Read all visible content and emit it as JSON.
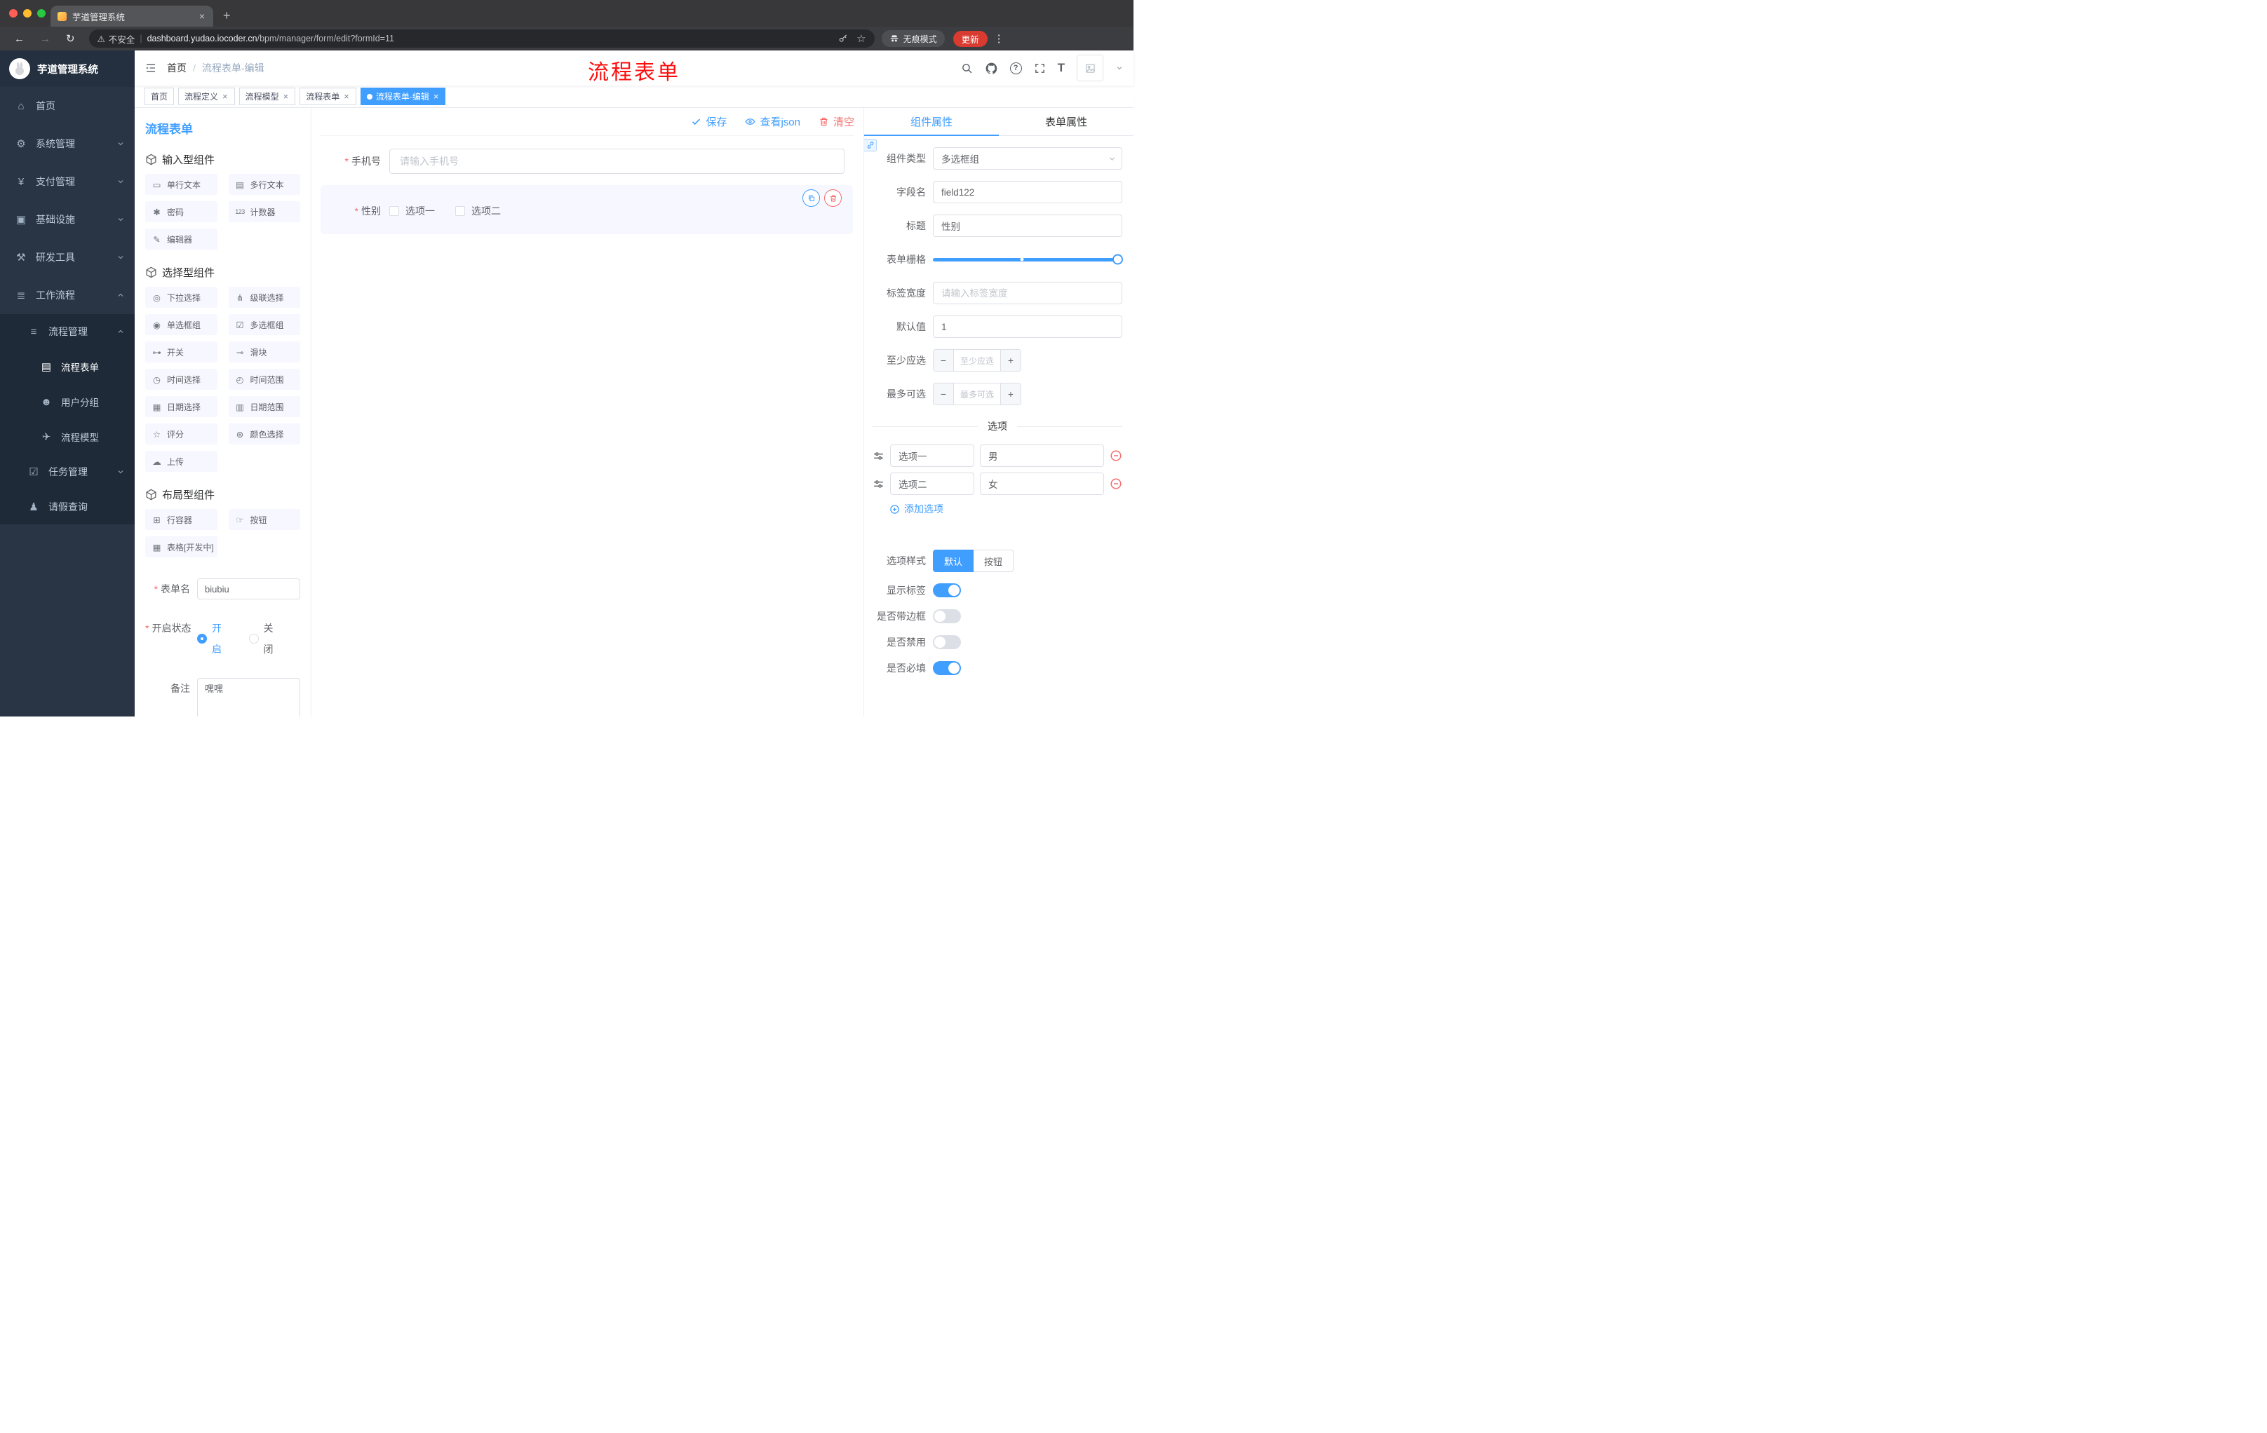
{
  "icons": {
    "close": "×",
    "plus": "+",
    "kebab": "⋮",
    "back": "←",
    "forward": "→",
    "reload": "↻",
    "star": "☆",
    "warning": "⚠",
    "pipe": "|",
    "breadcrumb_sep": "/",
    "question": "?",
    "text_size": "T"
  },
  "browser": {
    "tab_title": "芋道管理系统",
    "security_label": "不安全",
    "url_host": "dashboard.yudao.iocoder.cn",
    "url_path": "/bpm/manager/form/edit?formId=11",
    "incognito_label": "无痕模式",
    "update_label": "更新"
  },
  "sidebar": {
    "logo_title": "芋道管理系统",
    "menu": [
      {
        "label": "首页",
        "glyph": "⌂"
      },
      {
        "label": "系统管理",
        "glyph": "⚙"
      },
      {
        "label": "支付管理",
        "glyph": "¥"
      },
      {
        "label": "基础设施",
        "glyph": "▣"
      },
      {
        "label": "研发工具",
        "glyph": "⚒"
      },
      {
        "label": "工作流程",
        "glyph": "≣"
      }
    ],
    "submenu": {
      "process_mgmt": {
        "label": "流程管理",
        "glyph": "≡"
      },
      "children": [
        {
          "label": "流程表单",
          "glyph": "▤"
        },
        {
          "label": "用户分组",
          "glyph": "☻"
        },
        {
          "label": "流程模型",
          "glyph": "✈"
        }
      ],
      "task_mgmt": {
        "label": "任务管理",
        "glyph": "☑"
      },
      "leave_query": {
        "label": "请假查询",
        "glyph": "♟"
      }
    }
  },
  "header": {
    "breadcrumb_home": "首页",
    "breadcrumb_current": "流程表单-编辑",
    "overlay_title": "流程表单"
  },
  "tags": [
    {
      "label": "首页"
    },
    {
      "label": "流程定义"
    },
    {
      "label": "流程模型"
    },
    {
      "label": "流程表单"
    },
    {
      "label": "流程表单-编辑"
    }
  ],
  "palette": {
    "panel_title": "流程表单",
    "groups": [
      {
        "title": "输入型组件",
        "items": [
          {
            "label": "单行文本",
            "glyph": "▭"
          },
          {
            "label": "多行文本",
            "glyph": "▤"
          },
          {
            "label": "密码",
            "glyph": "✱"
          },
          {
            "label": "计数器",
            "glyph": "123"
          },
          {
            "label": "编辑器",
            "glyph": "✎"
          }
        ]
      },
      {
        "title": "选择型组件",
        "items": [
          {
            "label": "下拉选择",
            "glyph": "◎"
          },
          {
            "label": "级联选择",
            "glyph": "⋔"
          },
          {
            "label": "单选框组",
            "glyph": "◉"
          },
          {
            "label": "多选框组",
            "glyph": "☑"
          },
          {
            "label": "开关",
            "glyph": "⊶"
          },
          {
            "label": "滑块",
            "glyph": "⊸"
          },
          {
            "label": "时间选择",
            "glyph": "◷"
          },
          {
            "label": "时间范围",
            "glyph": "◴"
          },
          {
            "label": "日期选择",
            "glyph": "▦"
          },
          {
            "label": "日期范围",
            "glyph": "▥"
          },
          {
            "label": "评分",
            "glyph": "☆"
          },
          {
            "label": "颜色选择",
            "glyph": "⊛"
          },
          {
            "label": "上传",
            "glyph": "☁"
          }
        ]
      },
      {
        "title": "布局型组件",
        "items": [
          {
            "label": "行容器",
            "glyph": "⊞"
          },
          {
            "label": "按钮",
            "glyph": "☞"
          },
          {
            "label": "表格[开发中]",
            "glyph": "▦"
          }
        ]
      }
    ]
  },
  "left_form": {
    "form_name_label": "表单名",
    "form_name_value": "biubiu",
    "status_label": "开启状态",
    "status_on": "开启",
    "status_off": "关闭",
    "remark_label": "备注",
    "remark_value": "嘿嘿"
  },
  "canvas": {
    "save": "保存",
    "view_json": "查看json",
    "clear": "清空",
    "phone_label": "手机号",
    "phone_placeholder": "请输入手机号",
    "gender_label": "性别",
    "gender_option1": "选项一",
    "gender_option2": "选项二"
  },
  "inspector": {
    "tab_component": "组件属性",
    "tab_form": "表单属性",
    "type_label": "组件类型",
    "type_value": "多选框组",
    "field_label": "字段名",
    "field_value": "field122",
    "title_label": "标题",
    "title_value": "性别",
    "grid_label": "表单栅格",
    "label_width_label": "标签宽度",
    "label_width_placeholder": "请输入标签宽度",
    "default_label": "默认值",
    "default_value": "1",
    "min_label": "至少应选",
    "min_placeholder": "至少应选",
    "max_label": "最多可选",
    "max_placeholder": "最多可选",
    "stepper_minus": "−",
    "stepper_plus": "+",
    "options_divider": "选项",
    "option1_name": "选项一",
    "option1_value": "男",
    "option2_name": "选项二",
    "option2_value": "女",
    "add_option": "添加选项",
    "style_label": "选项样式",
    "style_default": "默认",
    "style_button": "按钮",
    "switch_show_label": "显示标签",
    "switch_border": "是否带边框",
    "switch_disabled": "是否禁用",
    "switch_required": "是否必填"
  },
  "colors": {
    "accent": "#409eff",
    "danger": "#f56c6c",
    "overlay_red": "#fd0d0d"
  }
}
